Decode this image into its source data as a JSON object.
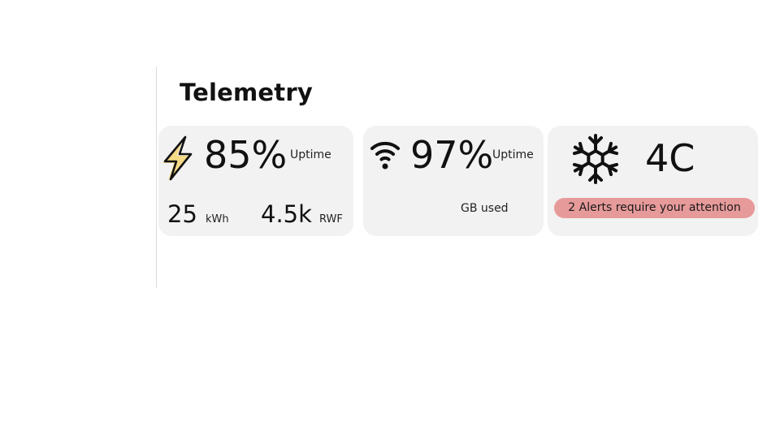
{
  "header": {
    "title": "Telemetry"
  },
  "power": {
    "icon": "lightning-bolt-icon",
    "uptime_value": "85%",
    "uptime_label": "Uptime",
    "energy_value": "25",
    "energy_unit": "kWh",
    "cost_value": "4.5k",
    "cost_unit": "RWF"
  },
  "network": {
    "icon": "wifi-icon",
    "uptime_value": "97%",
    "uptime_label": "Uptime",
    "data_label": "GB used"
  },
  "cooling": {
    "icon": "snowflake-icon",
    "temperature": "4C",
    "alert_text": "2 Alerts require your attention",
    "alert_color": "#e79a9a"
  },
  "colors": {
    "card_bg": "#f2f2f2",
    "bolt_fill": "#f7d774",
    "divider": "#dcdcdc"
  }
}
